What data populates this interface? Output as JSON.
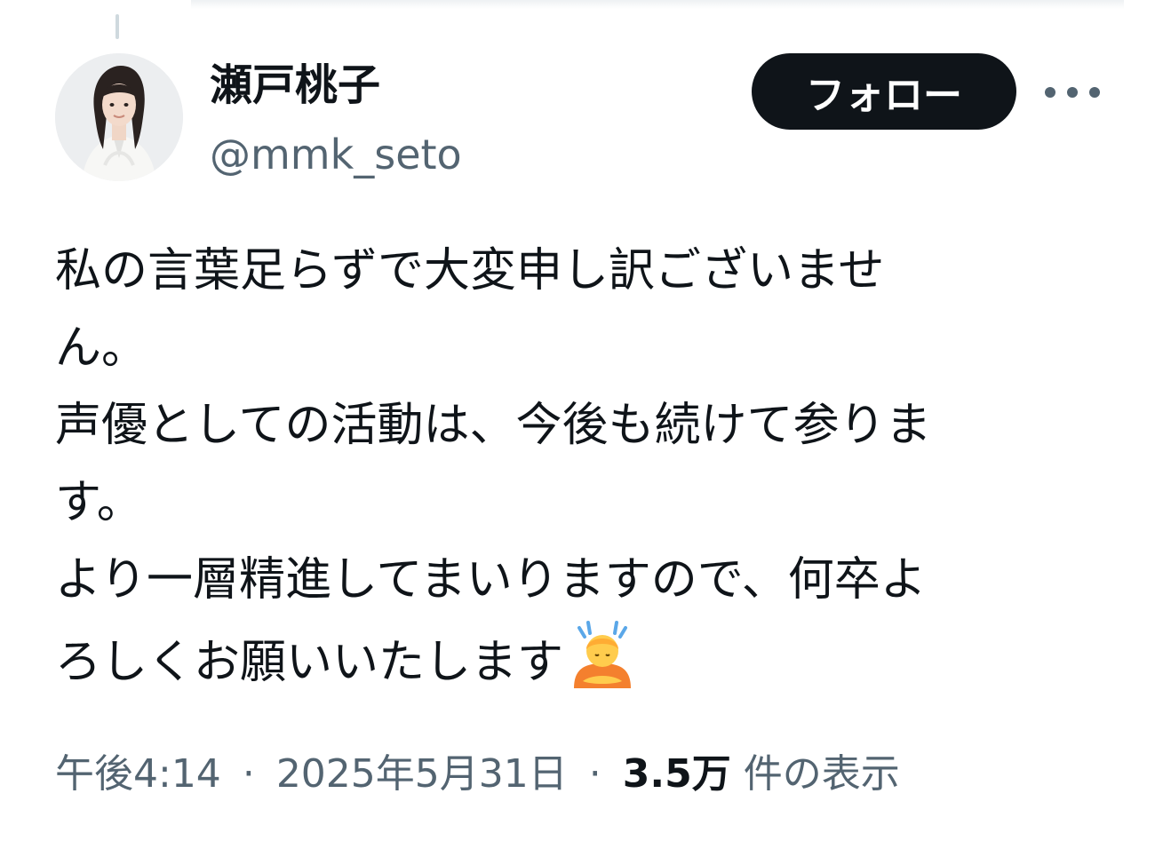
{
  "user": {
    "display_name": "瀬戸桃子",
    "handle": "@mmk_seto"
  },
  "follow_button": {
    "label": "フォロー"
  },
  "more_menu": {
    "icon": "more-dots-icon"
  },
  "tweet": {
    "lines": [
      "私の言葉足らずで大変申し訳ございませ",
      "ん。",
      "声優としての活動は、今後も続けて参りま",
      "す。",
      "より一層精進してまいりますので、何卒よ",
      "ろしくお願いいたします"
    ],
    "trailing_emoji": "person-bowing-emoji"
  },
  "meta": {
    "time": "午後4:14",
    "separator": "·",
    "date": "2025年5月31日",
    "views_count": "3.5万",
    "views_label": "件の表示"
  },
  "colors": {
    "text_primary": "#0f1419",
    "text_secondary": "#536471",
    "follow_bg": "#0f1419",
    "follow_fg": "#ffffff"
  }
}
